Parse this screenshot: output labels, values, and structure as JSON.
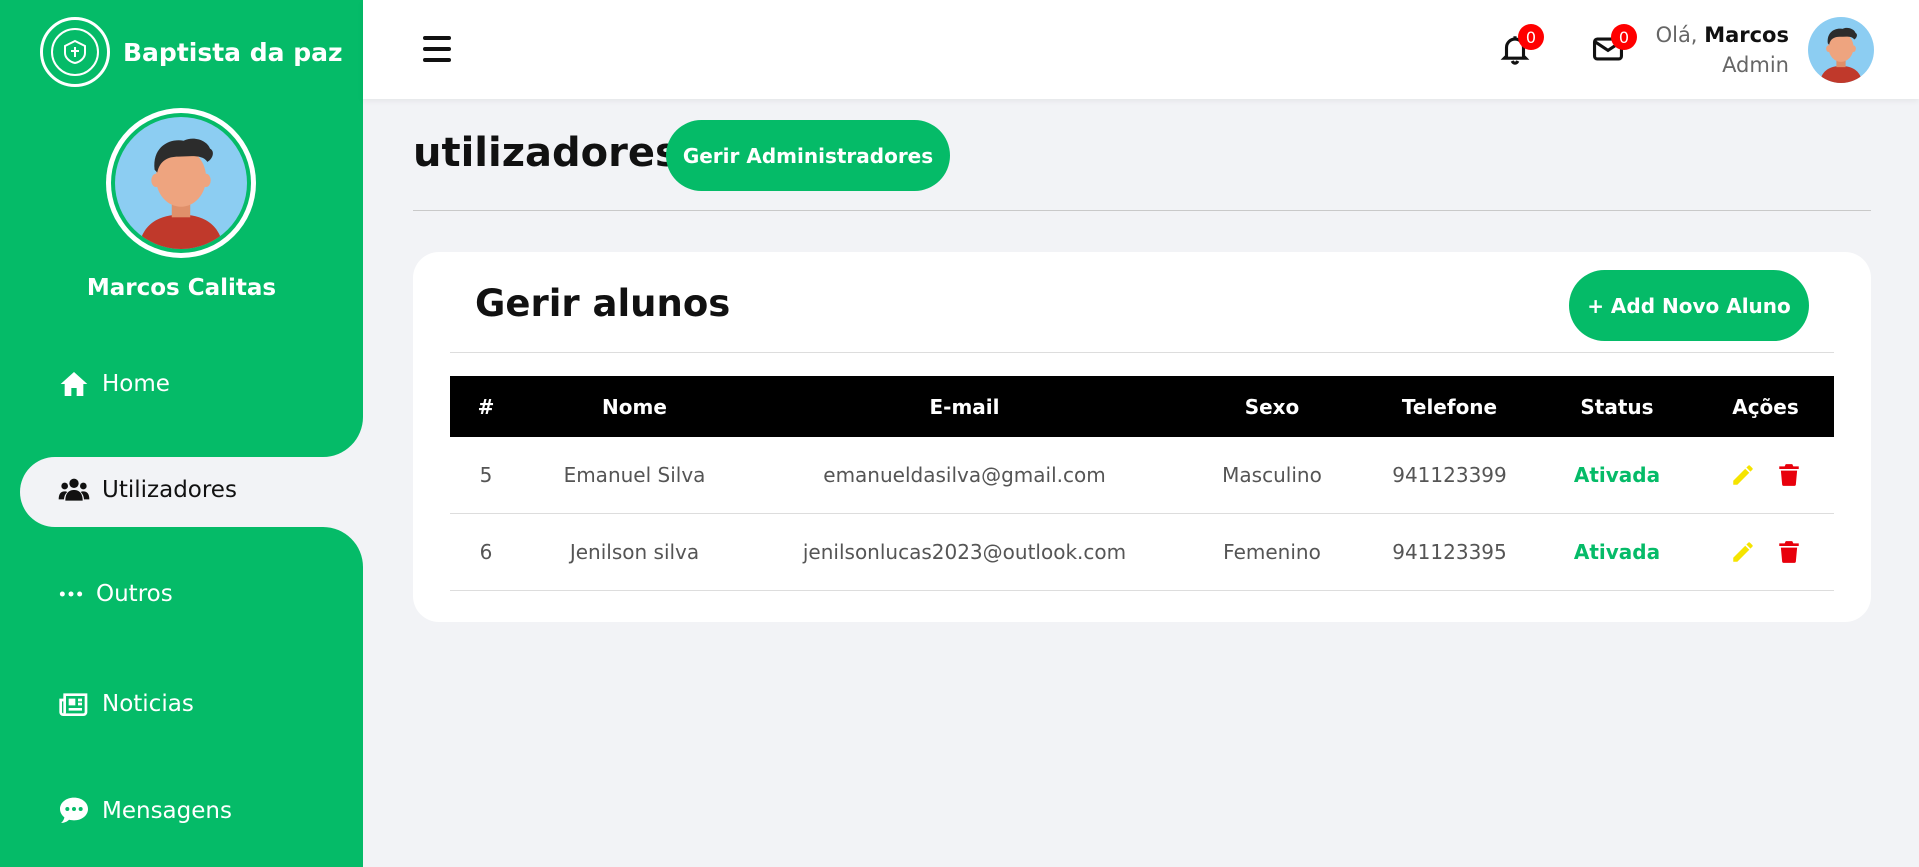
{
  "brand": {
    "name": "Baptista da paz"
  },
  "profile": {
    "name": "Marcos Calitas"
  },
  "sidebar": {
    "items": [
      {
        "label": "Home",
        "icon": "home-icon"
      },
      {
        "label": "Utilizadores",
        "icon": "users-icon",
        "active": true
      },
      {
        "label": "Outros",
        "icon": "more-icon"
      },
      {
        "label": "Noticias",
        "icon": "news-icon"
      },
      {
        "label": "Mensagens",
        "icon": "chat-icon"
      }
    ]
  },
  "topbar": {
    "notifications_count": "0",
    "messages_count": "0",
    "greeting": "Olá,",
    "user_name": "Marcos",
    "user_role": "Admin"
  },
  "page": {
    "title": "utilizadores",
    "manage_admins_label": "Gerir Administradores"
  },
  "card": {
    "title": "Gerir alunos",
    "add_label": "+ Add Novo Aluno"
  },
  "table": {
    "headers": [
      "#",
      "Nome",
      "E-mail",
      "Sexo",
      "Telefone",
      "Status",
      "Ações"
    ],
    "rows": [
      {
        "id": "5",
        "name": "Emanuel Silva",
        "email": "emanueldasilva@gmail.com",
        "sex": "Masculino",
        "phone": "941123399",
        "status": "Ativada"
      },
      {
        "id": "6",
        "name": "Jenilson silva",
        "email": "jenilsonlucas2023@outlook.com",
        "sex": "Femenino",
        "phone": "941123395",
        "status": "Ativada"
      }
    ]
  },
  "colors": {
    "accent": "#05bb68",
    "badge": "#ff0000",
    "edit": "#f5e400",
    "delete": "#e8000c"
  }
}
